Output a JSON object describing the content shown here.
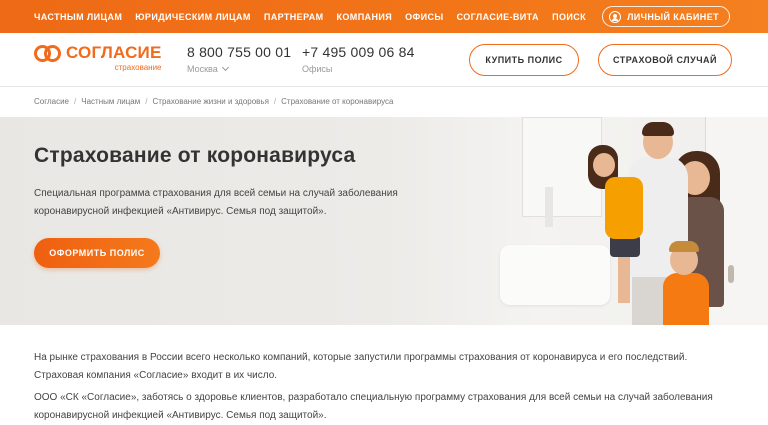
{
  "topnav": {
    "items": [
      "ЧАСТНЫМ ЛИЦАМ",
      "ЮРИДИЧЕСКИМ ЛИЦАМ",
      "ПАРТНЕРАМ",
      "КОМПАНИЯ",
      "ОФИСЫ",
      "СОГЛАСИЕ-ВИТА"
    ],
    "search": "ПОИСК",
    "cabinet": "ЛИЧНЫЙ КАБИНЕТ"
  },
  "header": {
    "logo_name": "СОГЛАСИЕ",
    "logo_sub": "страхование",
    "phone1": {
      "number": "8 800 755 00 01",
      "sub": "Москва"
    },
    "phone2": {
      "number": "+7 495 009 06 84",
      "sub": "Офисы"
    },
    "buy_label": "КУПИТЬ ПОЛИС",
    "claim_label": "СТРАХОВОЙ СЛУЧАЙ"
  },
  "breadcrumb": [
    "Согласие",
    "Частным лицам",
    "Страхование жизни и здоровья",
    "Страхование от коронавируса"
  ],
  "hero": {
    "title": "Страхование от коронавируса",
    "description": "Специальная программа страхования для всей семьи на случай заболевания коронавирусной инфекцией «Антивирус. Семья под защитой».",
    "cta_label": "ОФОРМИТЬ ПОЛИС"
  },
  "content": {
    "paragraphs": [
      "На рынке страхования в России всего несколько компаний, которые запустили программы страхования от коронавируса и его последствий. Страховая компания «Согласие» входит в их число.",
      "ООО «СК «Согласие», заботясь о здоровье клиентов, разработало специальную программу страхования для всей семьи на случай заболевания коронавирусной инфекцией «Антивирус. Семья под защитой»."
    ]
  },
  "colors": {
    "brand": "#f26a1b",
    "topbar": "#f07018"
  },
  "icons": {
    "cabinet": "user-icon",
    "city_dropdown": "chevron-down-icon"
  }
}
